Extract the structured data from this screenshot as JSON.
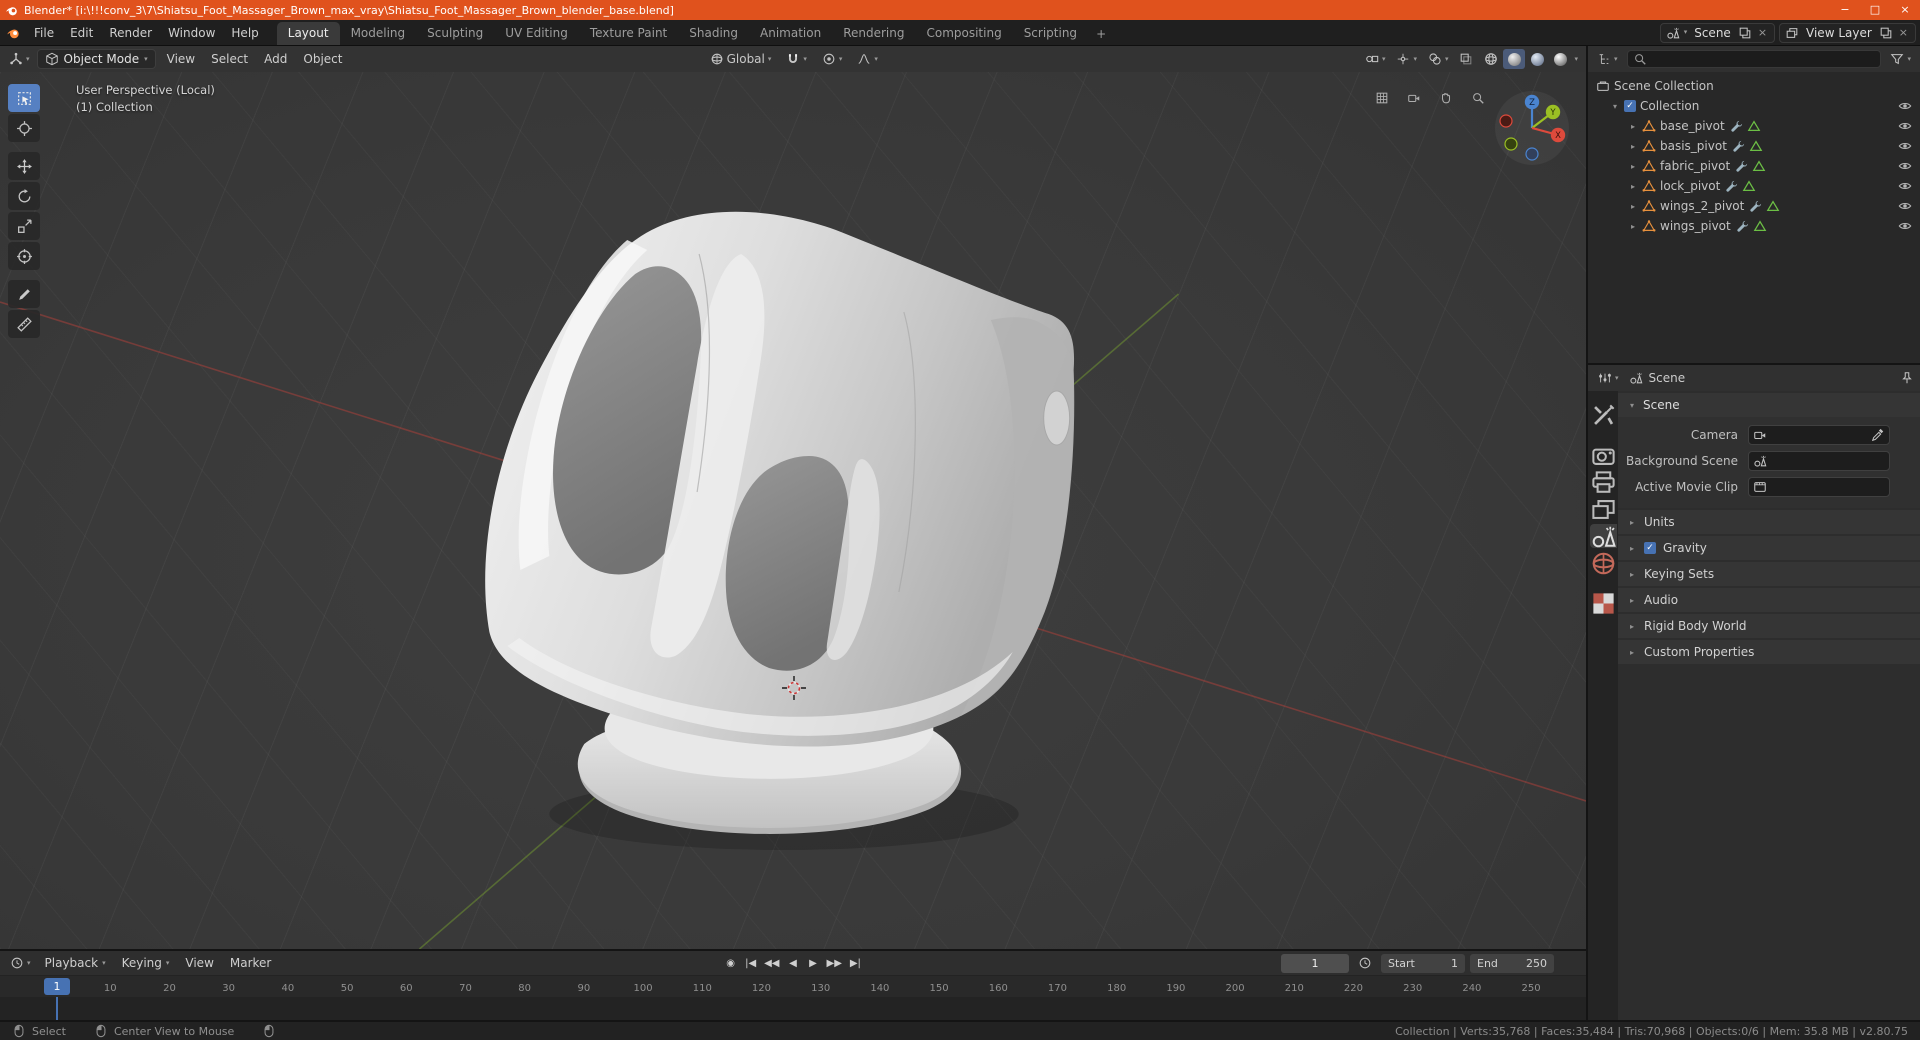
{
  "window": {
    "title": "Blender* [i:\\!!!conv_3\\7\\Shiatsu_Foot_Massager_Brown_max_vray\\Shiatsu_Foot_Massager_Brown_blender_base.blend]"
  },
  "icons": {
    "minimize": "−",
    "maximize": "□",
    "close": "×",
    "close_small": "×",
    "dropdown": "▾",
    "collapse_open": "▾",
    "collapse_closed": "▸",
    "check": "✓"
  },
  "topbar": {
    "menus": [
      "File",
      "Edit",
      "Render",
      "Window",
      "Help"
    ],
    "tabs": [
      "Layout",
      "Modeling",
      "Sculpting",
      "UV Editing",
      "Texture Paint",
      "Shading",
      "Animation",
      "Rendering",
      "Compositing",
      "Scripting"
    ],
    "active_tab": "Layout",
    "add_tab": "+",
    "scene_label": "Scene",
    "view_layer_label": "View Layer"
  },
  "viewport": {
    "header": {
      "mode": "Object Mode",
      "menus": [
        "View",
        "Select",
        "Add",
        "Object"
      ],
      "orientation": "Global",
      "shading_modes": [
        "wireframe",
        "solid",
        "material",
        "rendered"
      ],
      "active_shading": "solid"
    },
    "overlay": {
      "line1": "User Perspective (Local)",
      "line2": "(1) Collection"
    },
    "gizmo_axes": [
      "X",
      "Y",
      "Z"
    ]
  },
  "toolbar": {
    "tools": [
      "select-box",
      "cursor",
      "move",
      "rotate",
      "scale",
      "transform",
      "annotate",
      "measure"
    ],
    "active": "select-box"
  },
  "outliner": {
    "root_label": "Scene Collection",
    "collection": {
      "label": "Collection",
      "checked": true
    },
    "items": [
      {
        "name": "base_pivot"
      },
      {
        "name": "basis_pivot"
      },
      {
        "name": "fabric_pivot"
      },
      {
        "name": "lock_pivot"
      },
      {
        "name": "wings_2_pivot"
      },
      {
        "name": "wings_pivot"
      }
    ]
  },
  "properties": {
    "breadcrumb": "Scene",
    "tabs": [
      {
        "name": "tool",
        "group": 0
      },
      {
        "name": "render",
        "group": 1
      },
      {
        "name": "output",
        "group": 1
      },
      {
        "name": "view-layer",
        "group": 1
      },
      {
        "name": "scene",
        "group": 1,
        "active": true
      },
      {
        "name": "world",
        "group": 1
      },
      {
        "name": "texture",
        "group": 2
      }
    ],
    "scene_section": {
      "title": "Scene",
      "fields": [
        {
          "label": "Camera",
          "icon": "camera-data",
          "tail": "eyedropper"
        },
        {
          "label": "Background Scene",
          "icon": "scene-mini"
        },
        {
          "label": "Active Movie Clip",
          "icon": "clip"
        }
      ]
    },
    "sections": [
      {
        "label": "Units"
      },
      {
        "label": "Gravity",
        "checkbox": true,
        "checked": true
      },
      {
        "label": "Keying Sets"
      },
      {
        "label": "Audio"
      },
      {
        "label": "Rigid Body World"
      },
      {
        "label": "Custom Properties"
      }
    ]
  },
  "timeline": {
    "menus": [
      {
        "label": "Playback",
        "caret": true
      },
      {
        "label": "Keying",
        "caret": true
      },
      {
        "label": "View",
        "caret": false
      },
      {
        "label": "Marker",
        "caret": false
      }
    ],
    "transport": [
      {
        "name": "auto-key",
        "glyph": "◉"
      },
      {
        "name": "jump-to-start",
        "glyph": "|◀"
      },
      {
        "name": "prev-keyframe",
        "glyph": "◀◀"
      },
      {
        "name": "play-reverse",
        "glyph": "◀"
      },
      {
        "name": "play",
        "glyph": "▶"
      },
      {
        "name": "next-keyframe",
        "glyph": "▶▶"
      },
      {
        "name": "jump-to-end",
        "glyph": "▶|"
      }
    ],
    "current_frame": "1",
    "start_label": "Start",
    "start_value": "1",
    "end_label": "End",
    "end_value": "250",
    "playhead_frame": 1,
    "ticks": [
      10,
      20,
      30,
      40,
      50,
      60,
      70,
      80,
      90,
      100,
      110,
      120,
      130,
      140,
      150,
      160,
      170,
      180,
      190,
      200,
      210,
      220,
      230,
      240,
      250
    ]
  },
  "statusbar": {
    "hints": [
      {
        "icon": "mouse",
        "label": "Select"
      },
      {
        "icon": "mouse",
        "label": "Center View to Mouse"
      },
      {
        "icon": "mouse",
        "label": ""
      }
    ],
    "stats": [
      "Collection",
      "Verts:35,768",
      "Faces:35,484",
      "Tris:70,968",
      "Objects:0/6",
      "Mem: 35.8 MB",
      "v2.80.75"
    ],
    "separator": " | "
  },
  "colors": {
    "titlebar": "#e0521d",
    "accent_blue": "#4772b3",
    "active_tool": "#5680c2",
    "object_orange": "#e8913d",
    "axis_x": "#a8403a",
    "axis_y": "#6f9331",
    "gizmo_x": "#dd4a3c",
    "gizmo_y": "#9bc024",
    "gizmo_z": "#4a84d0"
  }
}
